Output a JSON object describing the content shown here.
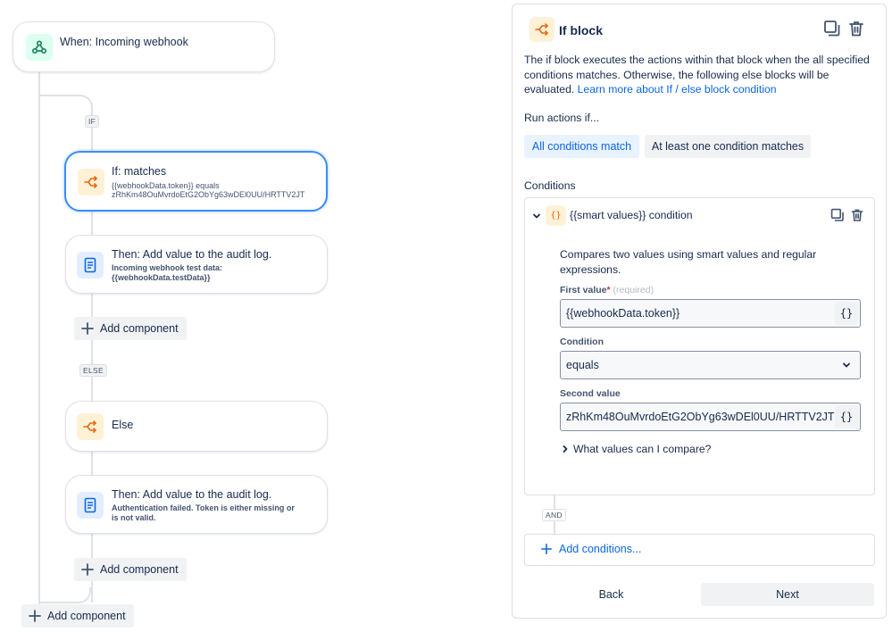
{
  "canvas": {
    "trigger": {
      "title": "When: Incoming webhook",
      "icon": "webhook-icon"
    },
    "if_tag": "IF",
    "else_tag": "ELSE",
    "if_card": {
      "title": "If: matches",
      "sub_line1": "{{webhookData.token}} equals",
      "sub_line2": "zRhKm48OuMvrdoEtG2ObYg63wDEl0UU/HRTTV2JT",
      "icon": "branch-icon"
    },
    "then_card_1": {
      "title": "Then: Add value to the audit log.",
      "sub_line1": "Incoming webhook test data:",
      "sub_line2": "{{webhookData.testData}}",
      "icon": "document-icon"
    },
    "add_component_1": "Add component",
    "else_card": {
      "title": "Else",
      "icon": "branch-icon"
    },
    "then_card_2": {
      "title": "Then: Add value to the audit log.",
      "sub_line1": "Authentication failed. Token is either missing or",
      "sub_line2": "is not valid.",
      "icon": "document-icon"
    },
    "add_component_2": "Add component",
    "add_component_3": "Add component"
  },
  "panel": {
    "title": "If block",
    "description": "The if block executes the actions within that block when the all specified conditions matches. Otherwise, the following else blocks will be evaluated.",
    "learn_more": "Learn more about If / else block condition",
    "run_actions_label": "Run actions if...",
    "match_options": [
      "All conditions match",
      "At least one condition matches"
    ],
    "selected_match_option": "All conditions match",
    "conditions_label": "Conditions",
    "condition": {
      "title": "{{smart values}} condition",
      "description": "Compares two values using smart values and regular expressions.",
      "first_value_label": "First value",
      "required_marker": "*",
      "required_hint": "(required)",
      "first_value": "{{webhookData.token}}",
      "condition_label": "Condition",
      "condition_value": "equals",
      "second_value_label": "Second value",
      "second_value": "zRhKm48OuMvrdoEtG2ObYg63wDEl0UU/HRTTV2JT",
      "smart_value_button": "{}",
      "compare_help": "What values can I compare?"
    },
    "and_tag": "AND",
    "add_conditions": "Add conditions...",
    "back": "Back",
    "next": "Next"
  },
  "colors": {
    "accent": "#0c66e4",
    "selected_border": "#388bff",
    "orange_icon": "#e56910",
    "green_icon": "#1f845a",
    "blue_icon": "#0c66e4"
  }
}
